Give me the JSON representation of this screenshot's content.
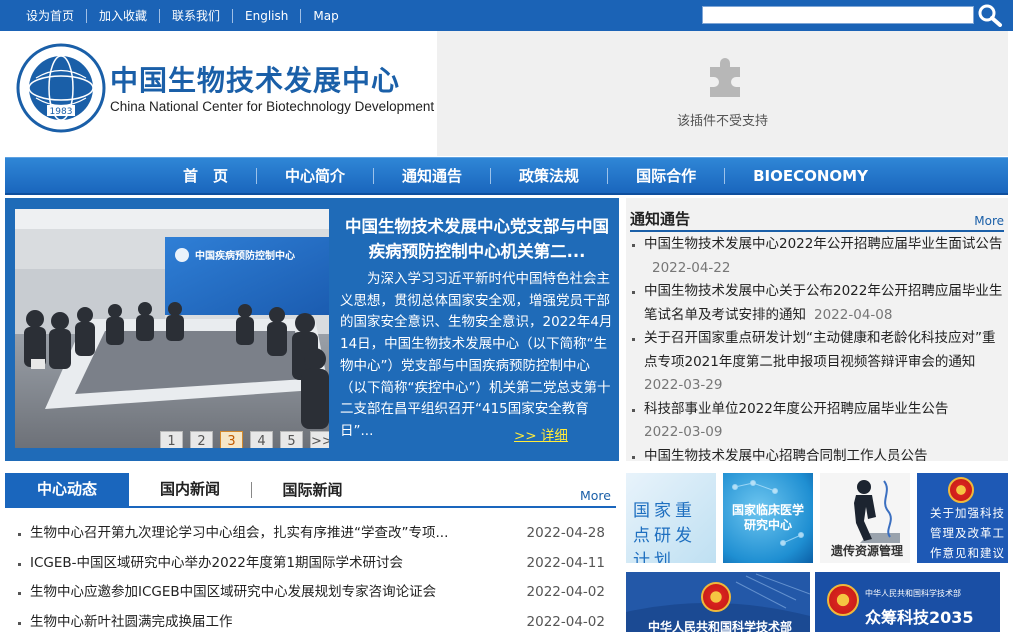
{
  "topbar": {
    "links": [
      "设为首页",
      "加入收藏",
      "联系我们",
      "English",
      "Map"
    ],
    "search_placeholder": ""
  },
  "header": {
    "logo_cn": "中国生物技术发展中心",
    "logo_en": "China National Center for Biotechnology Development",
    "logo_year": "1983",
    "plugin_text": "该插件不受支持"
  },
  "nav": {
    "items": [
      "首　页",
      "中心简介",
      "通知通告",
      "政策法规",
      "国际合作",
      "BIOECONOMY"
    ]
  },
  "feature": {
    "photo_sign": "中国疾病预防控制中心",
    "title": "中国生物技术发展中心党支部与中国疾病预防控制中心机关第二...",
    "body": "为深入学习习近平新时代中国特色社会主义思想，贯彻总体国家安全观，增强党员干部的国家安全意识、生物安全意识，2022年4月14日，中国生物技术发展中心（以下简称“生物中心”）党支部与中国疾病预防控制中心（以下简称“疾控中心”）机关第二党总支第十二支部在昌平组织召开“415国家安全教育日”...",
    "more": ">> 详细",
    "pages": [
      "1",
      "2",
      "3",
      "4",
      "5",
      ">>"
    ],
    "active_page": 3
  },
  "notice": {
    "title": "通知通告",
    "more": "More",
    "items": [
      {
        "text": "中国生物技术发展中心2022年公开招聘应届毕业生面试公告",
        "date": "2022-04-22"
      },
      {
        "text": "中国生物技术发展中心关于公布2022年公开招聘应届毕业生笔试名单及考试安排的通知",
        "date": "2022-04-08"
      },
      {
        "text": "关于召开国家重点研发计划“主动健康和老龄化科技应对”重点专项2021年度第二批申报项目视频答辩评审会的通知",
        "date": "2022-03-29"
      },
      {
        "text": "科技部事业单位2022年度公开招聘应届毕业生公告",
        "date": "2022-03-09"
      },
      {
        "text": "中国生物技术发展中心招聘合同制工作人员公告",
        "date": ""
      }
    ]
  },
  "news": {
    "tabs": [
      "中心动态",
      "国内新闻",
      "国际新闻"
    ],
    "more": "More",
    "items": [
      {
        "text": "生物中心召开第九次理论学习中心组会，扎实有序推进“学查改”专项...",
        "date": "2022-04-28"
      },
      {
        "text": "ICGEB-中国区域研究中心举办2022年度第1期国际学术研讨会",
        "date": "2022-04-11"
      },
      {
        "text": "生物中心应邀参加ICGEB中国区域研究中心发展规划专家咨询论证会",
        "date": "2022-04-02"
      },
      {
        "text": "生物中心新叶社圆满完成换届工作",
        "date": "2022-04-02"
      }
    ]
  },
  "banners": {
    "b1": "国家重点研发计划",
    "b2": "国家临床医学研究中心",
    "b3": "遗传资源管理",
    "b4": "关于加强科技管理及改革工作意见和建议",
    "b5": "中华人民共和国科学技术部",
    "b6_small": "中华人民共和国科学技术部",
    "b6_big": "众筹科技2035"
  },
  "colors": {
    "brand_blue": "#1b63b6",
    "feature_blue": "#1f6bb8",
    "link_yellow": "#ffeb3b"
  }
}
